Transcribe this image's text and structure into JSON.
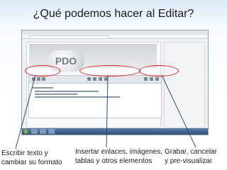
{
  "slide": {
    "title": "¿Qué podemos hacer al Editar?"
  },
  "screenshot": {
    "logo_text": "PDO",
    "icons": [
      "bold-icon",
      "italic-icon",
      "link-icon",
      "image-icon",
      "table-icon",
      "save-icon",
      "cancel-icon"
    ]
  },
  "annotations": [
    {
      "line1": "Escribir texto y",
      "line2": "cambiar su formato"
    },
    {
      "line1": "Insertar enlaces, imágenes,",
      "line2": "tablas y otros elementos"
    },
    {
      "line1": "Grabar, cancelar",
      "line2": "y pre-visualizar"
    }
  ],
  "colors": {
    "highlight": "#e02020",
    "title_text": "#1a1a1a"
  }
}
